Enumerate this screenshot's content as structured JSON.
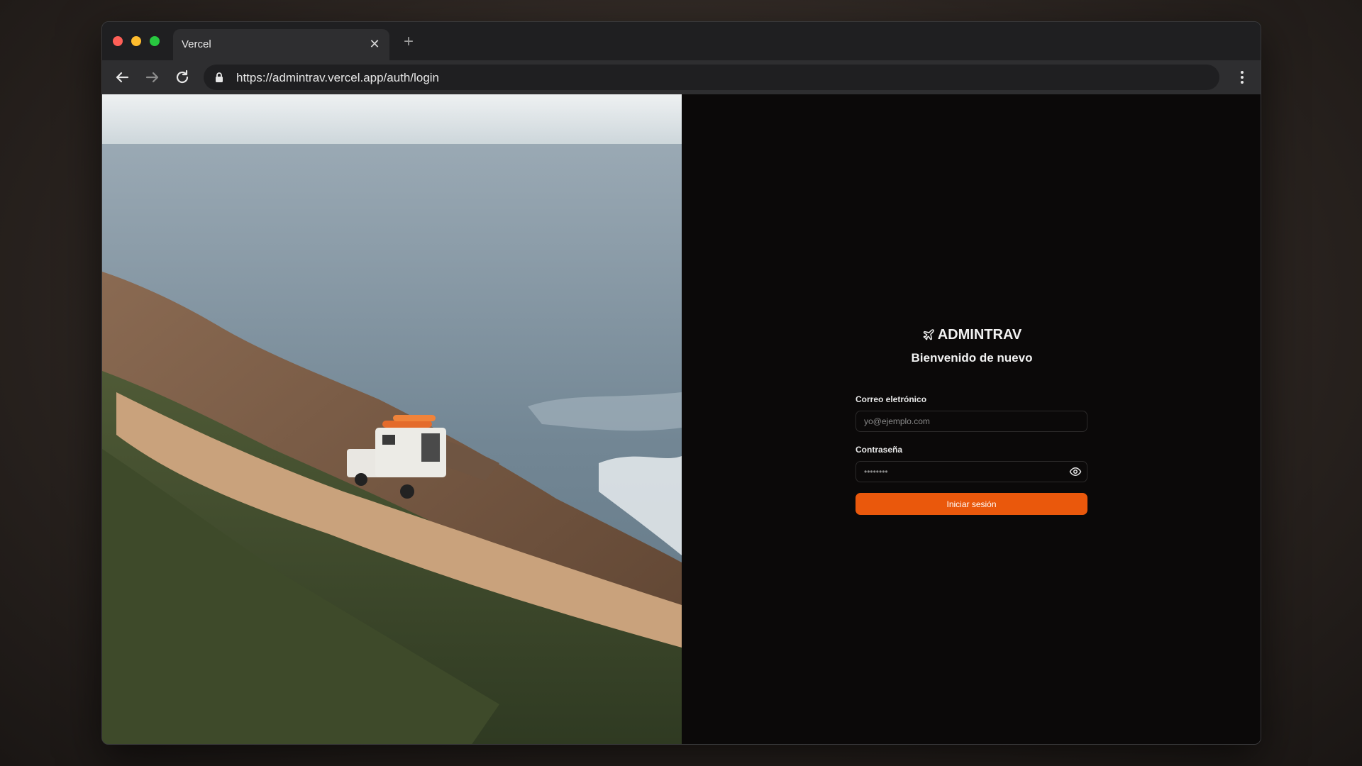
{
  "browser": {
    "tab_title": "Vercel",
    "url": "https://admintrav.vercel.app/auth/login",
    "icons": {
      "close": "close-icon",
      "new_tab": "plus-icon",
      "back": "arrow-left-icon",
      "forward": "arrow-right-icon",
      "reload": "reload-icon",
      "lock": "lock-icon",
      "menu": "more-vertical-icon"
    }
  },
  "login": {
    "brand_name": "ADMINTRAV",
    "brand_icon": "airplane-icon",
    "welcome": "Bienvenido de nuevo",
    "email_label": "Correo eletrónico",
    "email_placeholder": "yo@ejemplo.com",
    "email_value": "",
    "password_label": "Contraseña",
    "password_placeholder": "••••••••",
    "password_value": "",
    "toggle_icon": "eye-icon",
    "submit_label": "Iniciar sesión"
  },
  "colors": {
    "accent": "#ea580c",
    "panel_background": "#0b0909",
    "chrome_background": "#2e2e30"
  }
}
